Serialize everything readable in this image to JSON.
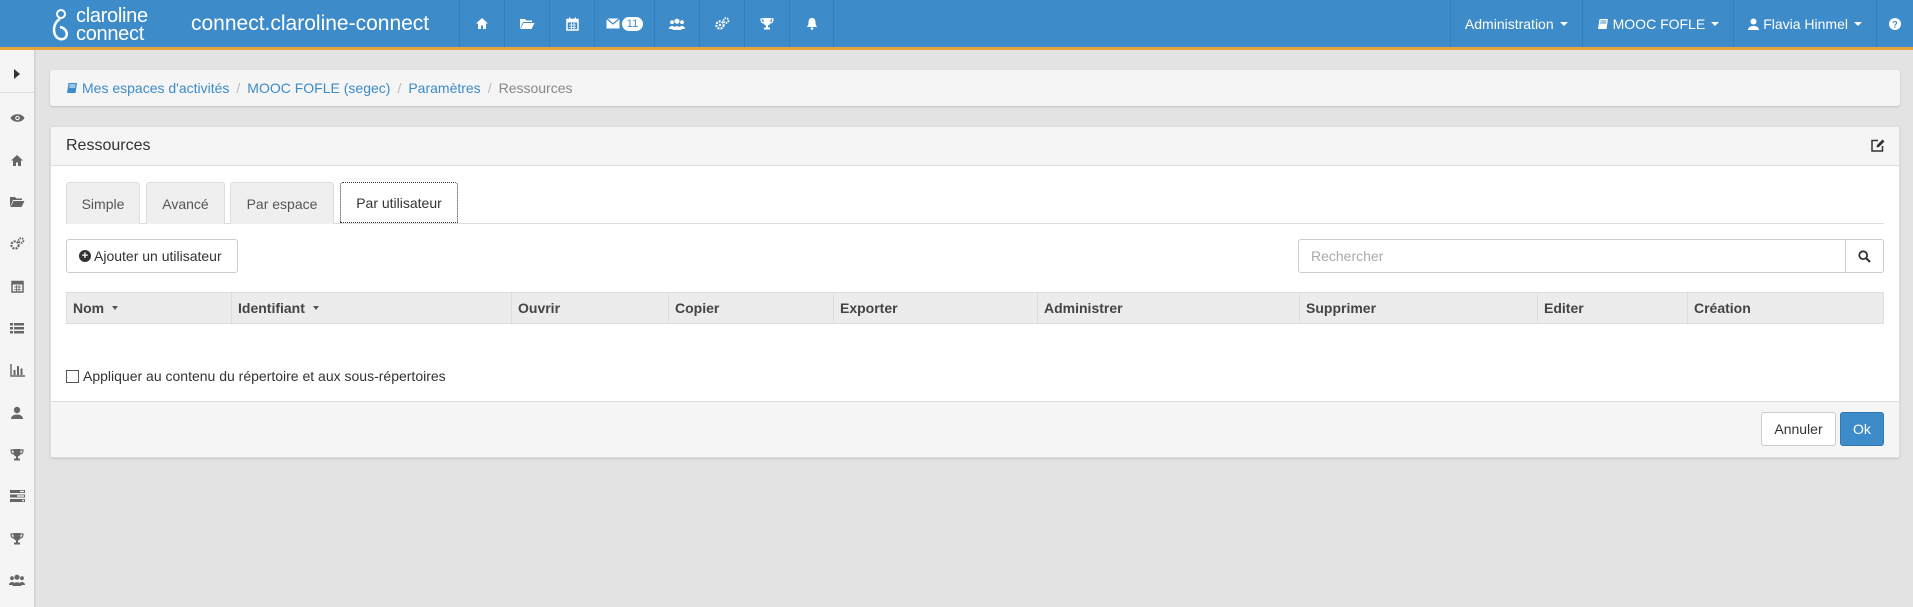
{
  "colors": {
    "primary": "#3d8bc9",
    "accent_border": "#e8a33b"
  },
  "logo": {
    "line1": "claroline",
    "line2": "connect"
  },
  "brand": "connect.claroline-connect",
  "nav": {
    "icons": [
      "home-icon",
      "folder-open-icon",
      "calendar-icon",
      "envelope-icon",
      "users-icon",
      "cogs-icon",
      "trophy-icon",
      "bell-icon"
    ],
    "messages_badge": "11",
    "administration_label": "Administration",
    "workspace_label": "MOOC FOFLE",
    "user_label": "Flavia Hinmel"
  },
  "sidebar": {
    "icons": [
      "eye-icon",
      "home-icon",
      "folder-open-icon",
      "cogs-icon",
      "calendar-icon",
      "list-icon",
      "bar-chart-icon",
      "user-icon",
      "trophy-icon",
      "tasks-icon",
      "trophy-icon",
      "users-icon"
    ]
  },
  "breadcrumb": {
    "items": [
      "Mes espaces d'activités",
      "MOOC FOFLE (segec)",
      "Paramètres"
    ],
    "active": "Ressources"
  },
  "panel": {
    "title": "Ressources",
    "tabs": [
      "Simple",
      "Avancé",
      "Par espace",
      "Par utilisateur"
    ],
    "active_tab": "Par utilisateur",
    "add_user_label": "Ajouter un utilisateur",
    "search_placeholder": "Rechercher",
    "columns": [
      "Nom",
      "Identifiant",
      "Ouvrir",
      "Copier",
      "Exporter",
      "Administrer",
      "Supprimer",
      "Editer",
      "Création"
    ],
    "apply_label": "Appliquer au contenu du répertoire et aux sous-répertoires",
    "cancel_label": "Annuler",
    "ok_label": "Ok"
  }
}
